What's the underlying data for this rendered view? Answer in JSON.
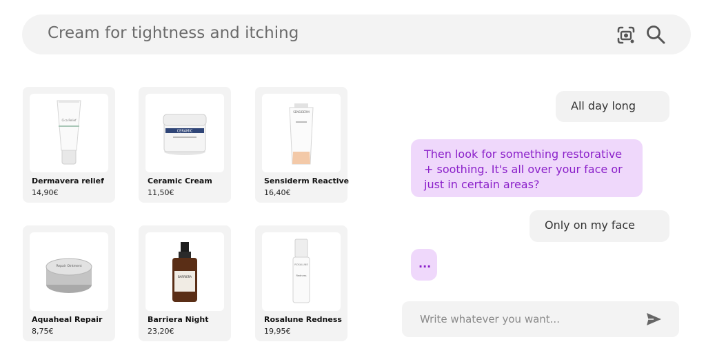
{
  "search": {
    "query": "Cream for tightness and itching",
    "icons": [
      "camera-search-icon",
      "search-icon"
    ]
  },
  "products": [
    {
      "name": "Dermavera relief",
      "price": "14,90€",
      "image": "white-tube",
      "label": "Cica Relief"
    },
    {
      "name": "Ceramic Cream",
      "price": "11,50€",
      "image": "white-jar",
      "label": "CERAMIC"
    },
    {
      "name": "Sensiderm Reactive",
      "price": "16,40€",
      "image": "peach-tube",
      "label": "SENSIDERM"
    },
    {
      "name": "Aquaheal Repair",
      "price": "8,75€",
      "image": "tin",
      "label": "Repair Ointment"
    },
    {
      "name": "Barriera Night",
      "price": "23,20€",
      "image": "amber-bottle",
      "label": "BARRIERA"
    },
    {
      "name": "Rosalune Redness",
      "price": "19,95€",
      "image": "pump-bottle",
      "label": "Redness"
    }
  ],
  "chat": {
    "messages": [
      {
        "role": "user",
        "text": "All day long"
      },
      {
        "role": "assistant",
        "text": "Then look for something restorative + soothing. It's all over your face or just in certain areas?"
      },
      {
        "role": "user",
        "text": "Only on my face"
      },
      {
        "role": "assistant",
        "text": "..."
      }
    ],
    "input_placeholder": "Write whatever you want...",
    "send_icon": "send-icon"
  },
  "colors": {
    "background": "#ffffff",
    "panel": "#f3f3f3",
    "assistant_bubble": "#efd8fb",
    "assistant_text": "#8a1fc9"
  }
}
